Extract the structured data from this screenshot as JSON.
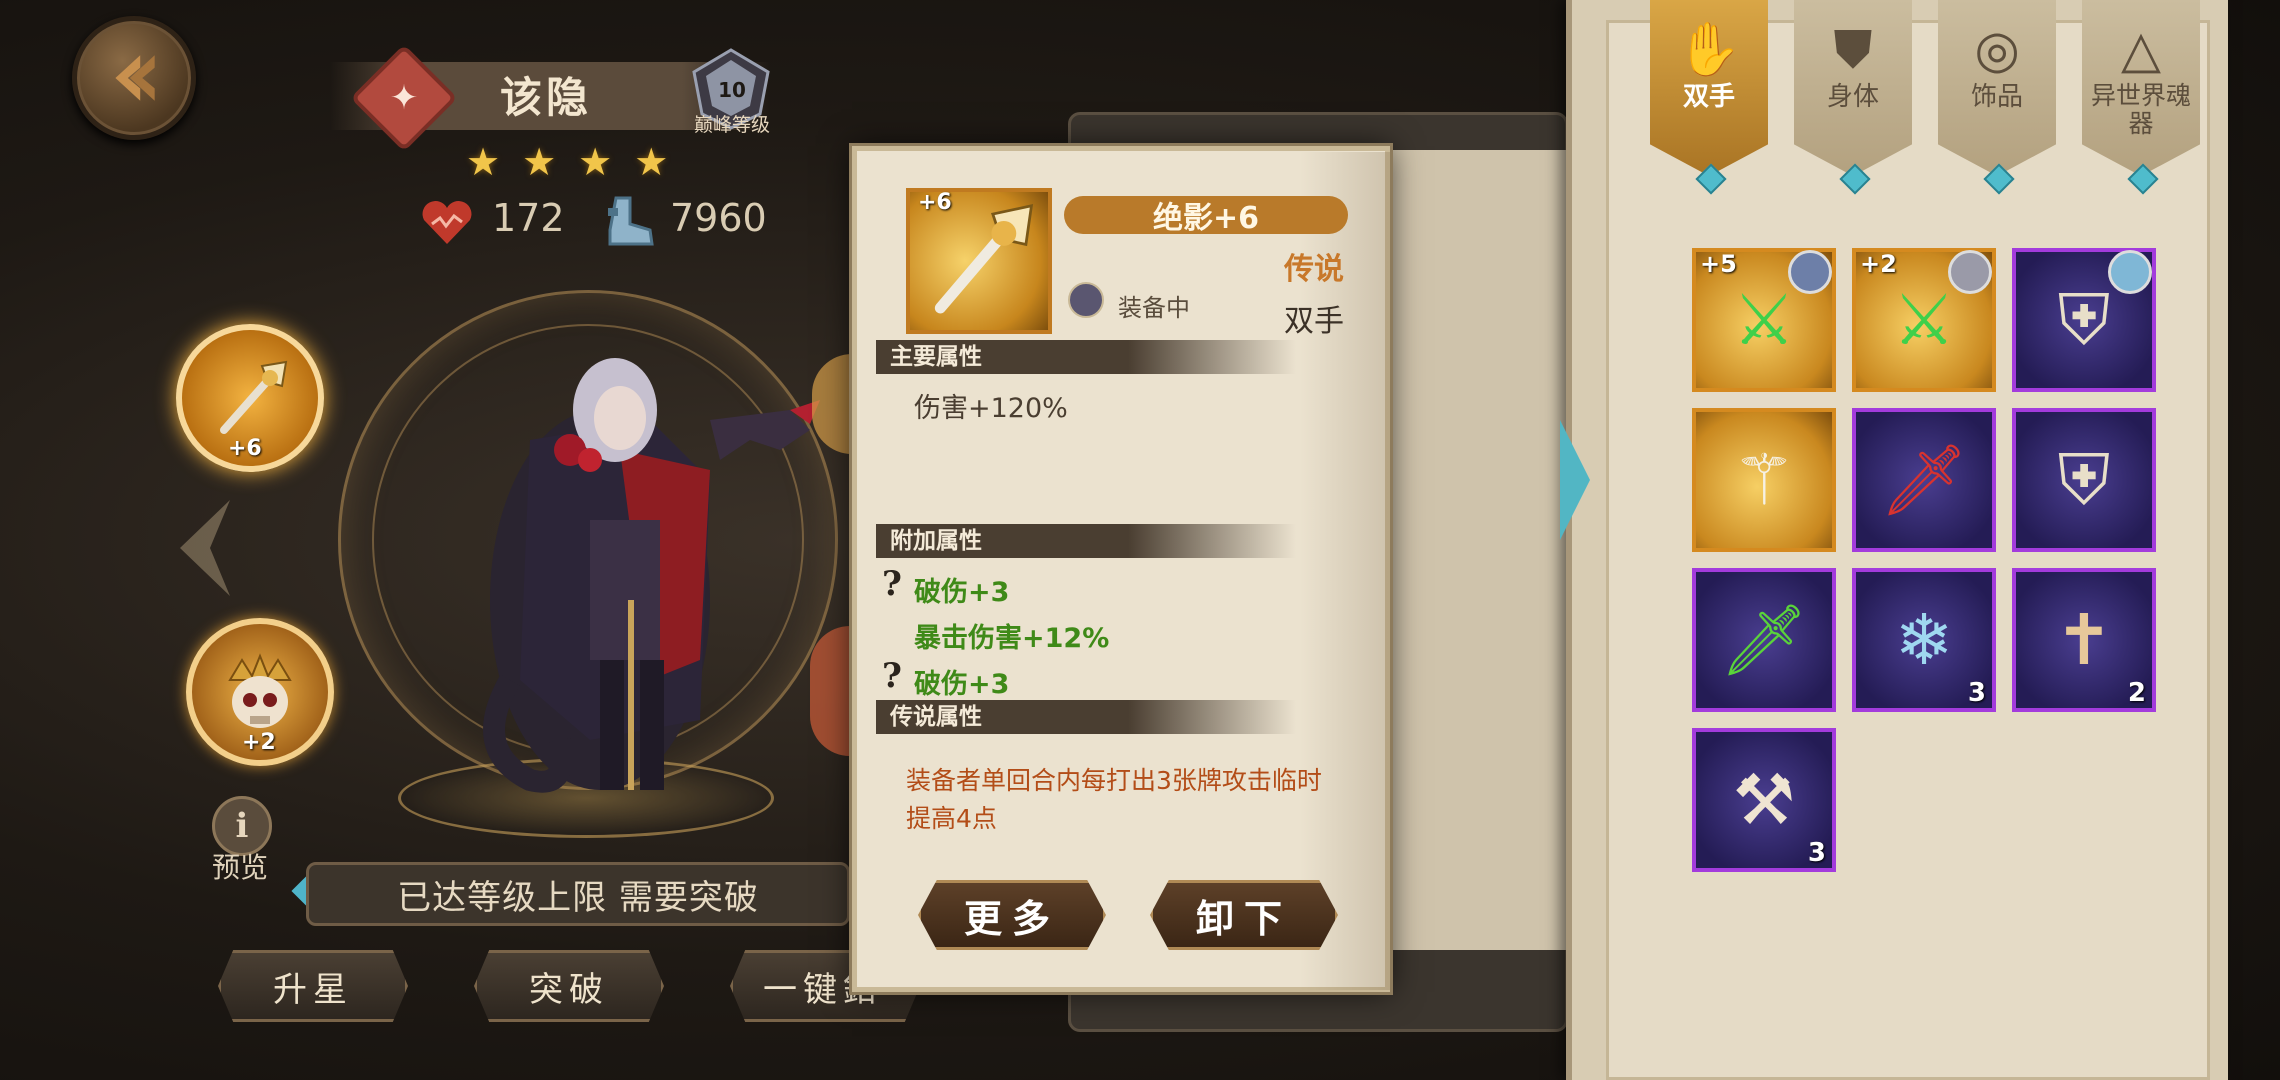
{
  "hero": {
    "name": "该隐",
    "peak_level": "10",
    "peak_label": "巅峰等级",
    "stars": 4,
    "hp": "172",
    "power": "7960",
    "slot1_plus": "+6",
    "slot2_plus": "+2",
    "preview_label": "预览",
    "limit_text": "已达等级上限 需要突破",
    "buttons": {
      "upstar": "升星",
      "break": "突破",
      "onekey": "一键鉬"
    }
  },
  "item_popup": {
    "plus": "+6",
    "name": "绝影+6",
    "rarity": "传说",
    "equipped_text": "装备中",
    "slot_type": "双手",
    "main_header": "主要属性",
    "main_attr": "伤害+120%",
    "extra_header": "附加属性",
    "extra_attrs": [
      "破伤+3",
      "暴击伤害+12%",
      "破伤+3"
    ],
    "legend_header": "传说属性",
    "legend_text": "装备者单回合内每打出3张牌攻击临时提高4点",
    "btn_more": "更多",
    "btn_unequip": "卸下"
  },
  "inventory": {
    "tabs": [
      {
        "label": "双手",
        "icon": "glove-icon",
        "active": true
      },
      {
        "label": "身体",
        "icon": "armor-icon",
        "active": false
      },
      {
        "label": "饰品",
        "icon": "ring-icon",
        "active": false
      },
      {
        "label": "异世界魂器",
        "icon": "eye-pyramid-icon",
        "active": false
      }
    ],
    "items": [
      {
        "name": "poison-blade-item",
        "rarity": "gold",
        "plus": "+5",
        "owner": true,
        "count": ""
      },
      {
        "name": "poison-blade-item",
        "rarity": "gold",
        "plus": "+2",
        "owner": true,
        "count": ""
      },
      {
        "name": "crest-shield-item",
        "rarity": "purple",
        "plus": "",
        "owner": true,
        "count": ""
      },
      {
        "name": "golden-scepter-item",
        "rarity": "gold",
        "plus": "",
        "owner": false,
        "count": ""
      },
      {
        "name": "crimson-sword-item",
        "rarity": "purple",
        "plus": "",
        "owner": false,
        "count": ""
      },
      {
        "name": "crest-shield-item",
        "rarity": "purple",
        "plus": "",
        "owner": false,
        "count": ""
      },
      {
        "name": "green-dagger-item",
        "rarity": "purple",
        "plus": "",
        "owner": false,
        "count": ""
      },
      {
        "name": "ice-claw-item",
        "rarity": "purple",
        "plus": "",
        "owner": false,
        "count": "3"
      },
      {
        "name": "cross-sword-item",
        "rarity": "purple",
        "plus": "",
        "owner": false,
        "count": "2"
      },
      {
        "name": "bone-mace-item",
        "rarity": "purple",
        "plus": "",
        "owner": false,
        "count": "3"
      }
    ]
  },
  "colors": {
    "gold_accent": "#d9a646",
    "legend_red": "#b34d18",
    "extra_green": "#3f8a18",
    "purple_frame": "#a33bdc"
  }
}
